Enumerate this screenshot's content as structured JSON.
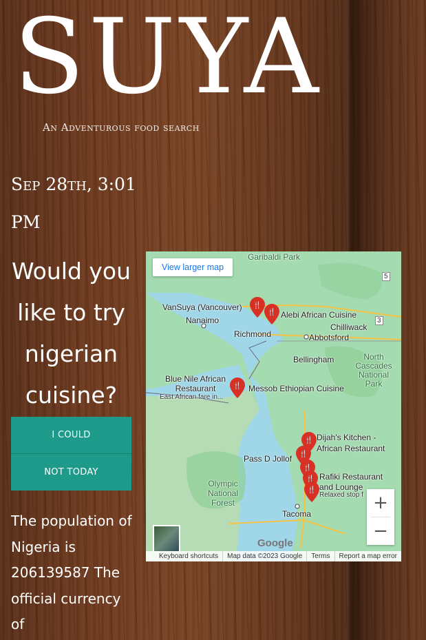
{
  "header": {
    "title": "SUYA",
    "tagline": "An Adventurous food search"
  },
  "datetime": "Sep 28th, 3:01 PM",
  "prompt": {
    "question": "Would you like to try nigerian cuisine?",
    "yes_label": "I could",
    "no_label": "Not today"
  },
  "facts": {
    "text": "The population of Nigeria is 206139587 The official currency of"
  },
  "map": {
    "view_larger": "View larger map",
    "labels": {
      "garibaldi": "Garibaldi Park",
      "vansuya": "VanSuya (Vancouver)",
      "nanaimo": "Nanaimo",
      "richmond": "Richmond",
      "alebi": "Alebi African Cuisine",
      "chilliwack": "Chilliwack",
      "abbotsford": "Abbotsford",
      "bellingham": "Bellingham",
      "north_cascades": "North Cascades National Park",
      "blue_nile": "Blue Nile African Restaurant",
      "blue_nile_sub": "East African fare in...",
      "messob": "Messob Ethiopian Cuisine",
      "dijah": "Dijah's Kitchen - African Restaurant",
      "pass_d": "Pass D Jollof",
      "olympic": "Olympic National Forest",
      "rafiki": "Rafiki Restaurant and Lounge",
      "rafiki_sub": "Relaxed stop f",
      "tacoma": "Tacoma",
      "hwy5": "5",
      "hwy3": "3"
    },
    "zoom_in": "+",
    "zoom_out": "−",
    "google": "Google",
    "footer": {
      "shortcuts": "Keyboard shortcuts",
      "data": "Map data ©2023 Google",
      "terms": "Terms",
      "report": "Report a map error"
    }
  },
  "colors": {
    "button": "#1d9a8a",
    "map_water": "#9fd6e8",
    "map_land": "#a5dbb0",
    "pin": "#d93025"
  }
}
